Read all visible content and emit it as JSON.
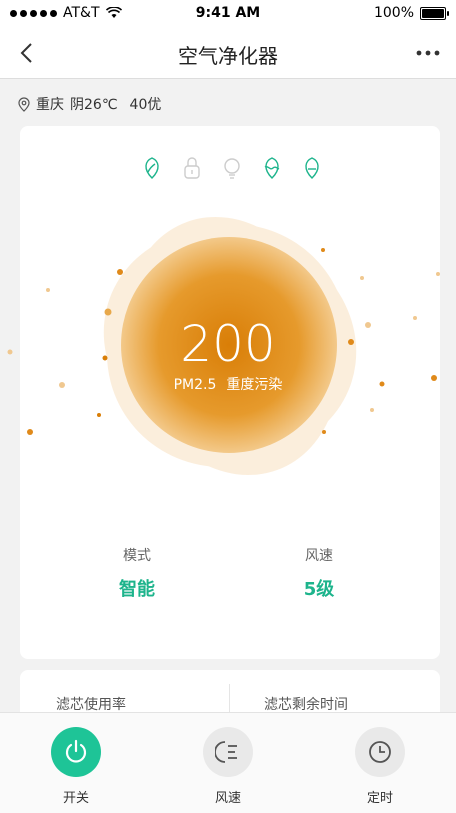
{
  "status_bar": {
    "carrier": "AT&T",
    "time": "9:41 AM",
    "battery": "100%"
  },
  "nav": {
    "title": "空气净化器"
  },
  "location": {
    "city": "重庆",
    "weather": "阴26℃",
    "aqi": "40优"
  },
  "reading": {
    "value": "200",
    "metric": "PM2.5",
    "level": "重度污染"
  },
  "mode_icons": [
    "leaf-icon",
    "lock-icon",
    "bulb-icon",
    "wave-leaf-icon",
    "minus-leaf-icon"
  ],
  "stats": {
    "mode_label": "模式",
    "mode_value": "智能",
    "speed_label": "风速",
    "speed_value": "5级"
  },
  "filter": {
    "usage_label": "滤芯使用率",
    "remaining_label": "滤芯剩余时间"
  },
  "tabs": [
    {
      "label": "开关",
      "icon": "power-icon",
      "active": true
    },
    {
      "label": "风速",
      "icon": "fan-speed-icon",
      "active": false
    },
    {
      "label": "定时",
      "icon": "clock-icon",
      "active": false
    }
  ],
  "colors": {
    "accent": "#1db48c",
    "orb": "#e38d12"
  }
}
